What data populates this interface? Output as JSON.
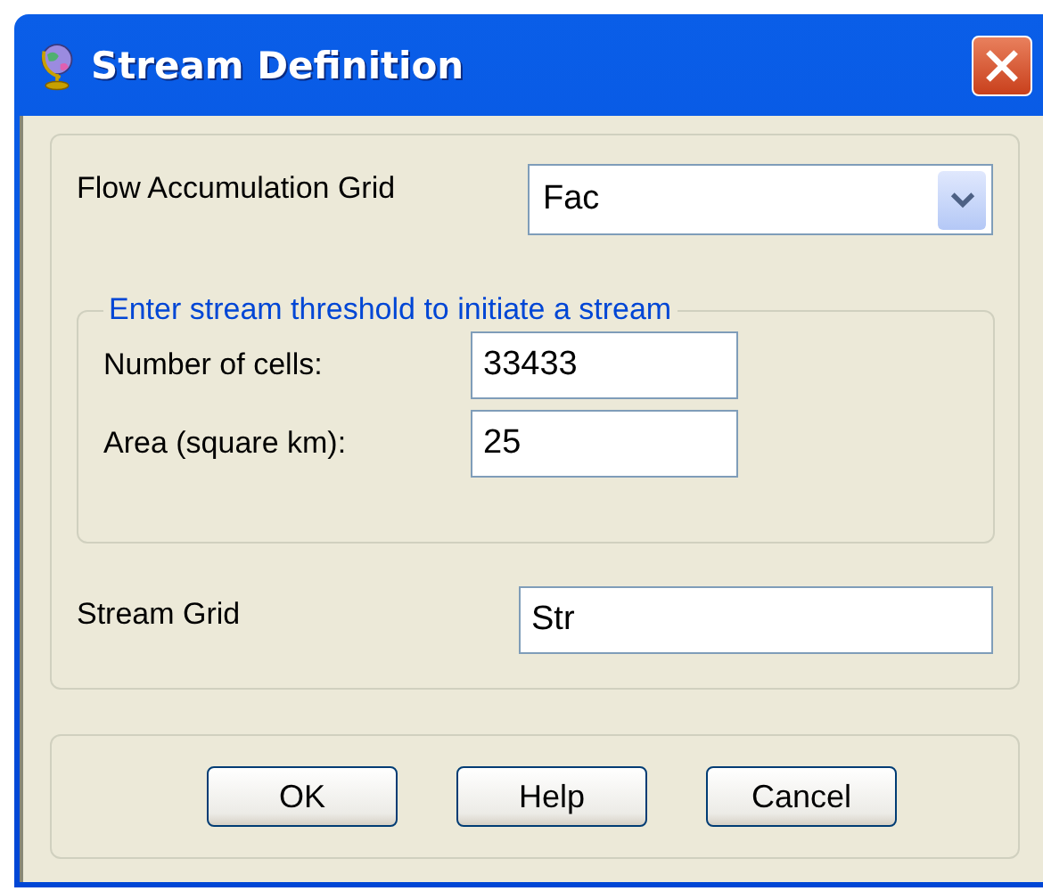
{
  "window": {
    "title": "Stream Definition"
  },
  "flow_accumulation_grid": {
    "label": "Flow Accumulation Grid",
    "value": "Fac"
  },
  "threshold_group": {
    "legend": "Enter stream threshold to initiate a stream",
    "fields": [
      {
        "label": "Number of cells:",
        "value": "33433"
      },
      {
        "label": "Area (square km):",
        "value": "25"
      }
    ]
  },
  "stream_grid": {
    "label": "Stream Grid",
    "value": "Str"
  },
  "buttons": [
    {
      "label": "OK"
    },
    {
      "label": "Help"
    },
    {
      "label": "Cancel"
    }
  ]
}
